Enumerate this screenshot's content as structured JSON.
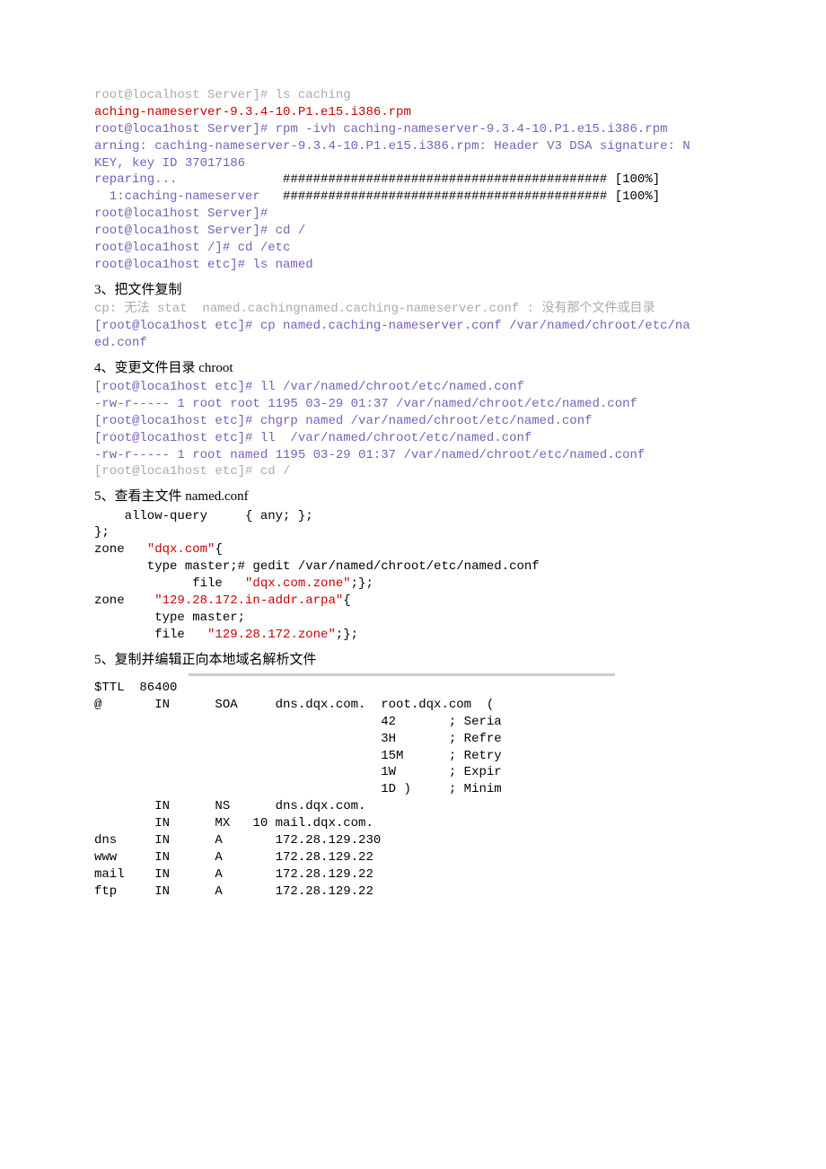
{
  "block1": {
    "l1": "root@localhost Server]# ls caching",
    "l2": "aching-nameserver-9.3.4-10.P1.e15.i386.rpm",
    "l3": "root@loca1host Server]# rpm -ivh caching-nameserver-9.3.4-10.P1.e15.i386.rpm",
    "l4": "arning: caching-nameserver-9.3.4-10.P1.e15.i386.rpm: Header V3 DSA signature: N",
    "l5": "KEY, key ID 37017186",
    "l6a": "reparing...              ",
    "l6b": "########################################### [100%]",
    "l7a": "  1:caching-nameserver   ",
    "l7b": "########################################### [100%]",
    "l8": "",
    "l9": "root@loca1host Server]#",
    "l10": "root@loca1host Server]# cd /",
    "l11": "root@loca1host /]# cd /etc",
    "l12": "root@loca1host etc]# ls named"
  },
  "heading3": "3、把文件复制",
  "block3": {
    "l1": "cp: 无法 stat  named.cachingnamed.caching-nameserver.conf : 没有那个文件或目录",
    "l2": "[root@loca1host etc]# cp named.caching-nameserver.conf /var/named/chroot/etc/na",
    "l3": "ed.conf"
  },
  "heading4": "4、变更文件目录 chroot",
  "block4": {
    "l1": "[root@loca1host etc]# ll /var/named/chroot/etc/named.conf",
    "l2": "-rw-r----- 1 root root 1195 03-29 01:37 /var/named/chroot/etc/named.conf",
    "l3": "[root@loca1host etc]# chgrp named /var/named/chroot/etc/named.conf",
    "l4": "[root@loca1host etc]# ll  /var/named/chroot/etc/named.conf",
    "l5": "-rw-r----- 1 root named 1195 03-29 01:37 /var/named/chroot/etc/named.conf",
    "l6": "[root@loca1host etc]# cd /"
  },
  "heading5a": "5、查看主文件 named.conf",
  "block5a": {
    "l1": "    allow-query     { any; };",
    "l2": "",
    "l3": "",
    "l4": "};",
    "l5a": "zone   ",
    "l5b": "\"dqx.com\"",
    "l5c": "{",
    "l6": "       type master;# gedit /var/named/chroot/etc/named.conf",
    "l7": "",
    "l8a": "             file   ",
    "l8b": "\"dqx.com.zone\"",
    "l8c": ";};",
    "l9a": "zone    ",
    "l9b": "\"129.28.172.in-addr.arpa\"",
    "l9c": "{",
    "l10": "        type master;",
    "l11a": "        file   ",
    "l11b": "\"129.28.172.zone\"",
    "l11c": ";};"
  },
  "heading5b": "5、复制并编辑正向本地域名解析文件",
  "zone": {
    "r1": "$TTL  86400",
    "r2": "@       IN      SOA     dns.dqx.com.  root.dqx.com  (",
    "r3": "                                      42       ; Seria",
    "r4": "                                      3H       ; Refre",
    "r5": "                                      15M      ; Retry",
    "r6": "                                      1W       ; Expir",
    "r7": "                                      1D )     ; Minim",
    "r8": "",
    "r9": "        IN      NS      dns.dqx.com.",
    "r10": "        IN      MX   10 mail.dqx.com.",
    "r11": "dns     IN      A       172.28.129.230",
    "r12": "www     IN      A       172.28.129.22",
    "r13": "mail    IN      A       172.28.129.22",
    "r14": "ftp     IN      A       172.28.129.22"
  }
}
